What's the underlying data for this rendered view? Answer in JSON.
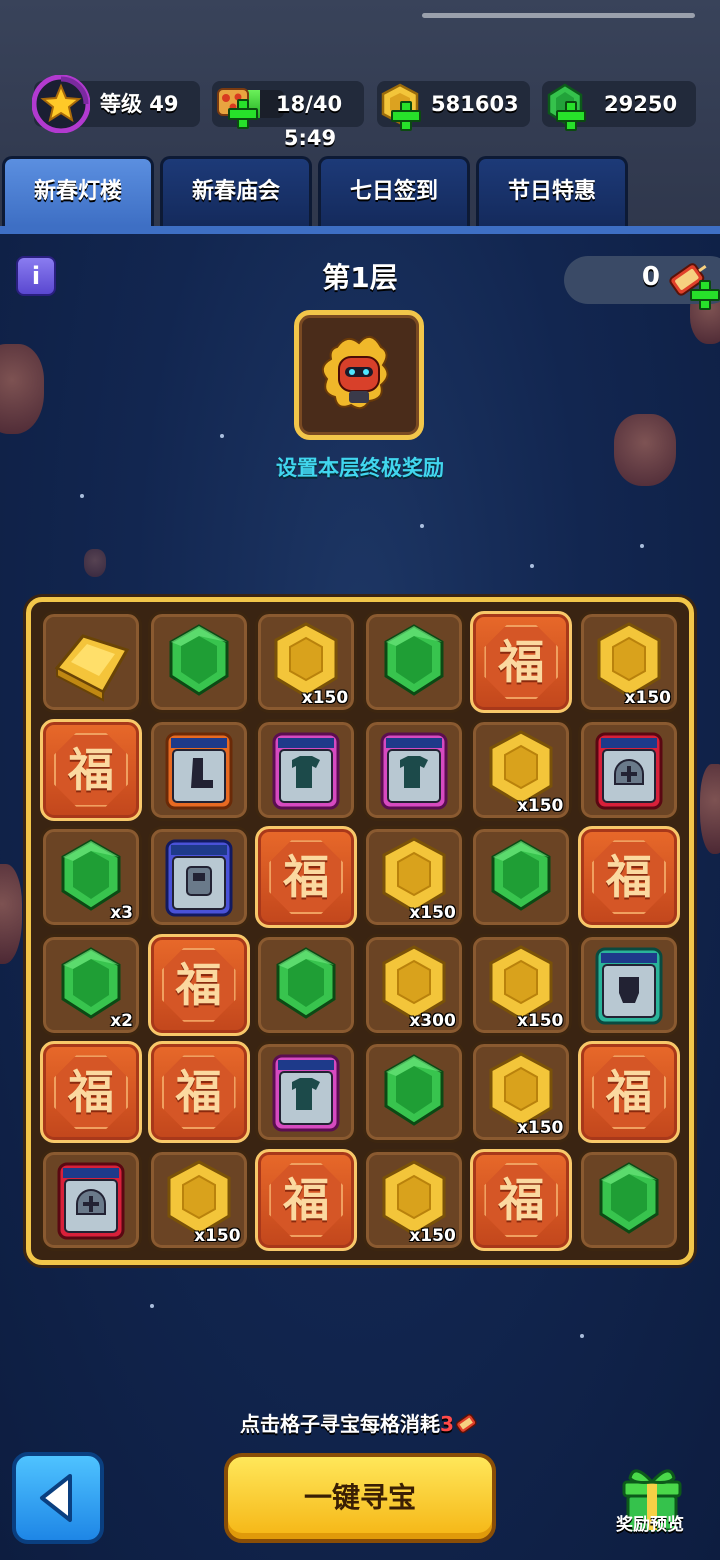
{
  "header": {
    "level_label": "等级 49",
    "energy": "18/40",
    "energy_fill": 0.45,
    "energy_timer": "5:49",
    "coins": "581603",
    "gems": "29250"
  },
  "tabs": [
    {
      "label": "新春灯楼",
      "active": true
    },
    {
      "label": "新春庙会",
      "active": false
    },
    {
      "label": "七日签到",
      "active": false
    },
    {
      "label": "节日特惠",
      "active": false
    }
  ],
  "floor": {
    "title": "第1层",
    "ticket_count": "0",
    "reward_label": "设置本层终极奖励"
  },
  "grid": [
    [
      {
        "type": "gold-bar",
        "qty": ""
      },
      {
        "type": "gem",
        "qty": ""
      },
      {
        "type": "coin",
        "qty": "x150"
      },
      {
        "type": "gem",
        "qty": ""
      },
      {
        "type": "fu",
        "qty": ""
      },
      {
        "type": "coin",
        "qty": "x150"
      }
    ],
    [
      {
        "type": "fu",
        "qty": ""
      },
      {
        "type": "card-orange-boot",
        "qty": ""
      },
      {
        "type": "card-pink-shirt",
        "qty": ""
      },
      {
        "type": "card-pink-shirt",
        "qty": ""
      },
      {
        "type": "coin",
        "qty": "x150"
      },
      {
        "type": "card-red-helmet",
        "qty": ""
      }
    ],
    [
      {
        "type": "gem",
        "qty": "x3"
      },
      {
        "type": "card-blue-armor",
        "qty": ""
      },
      {
        "type": "fu",
        "qty": ""
      },
      {
        "type": "coin",
        "qty": "x150"
      },
      {
        "type": "gem",
        "qty": ""
      },
      {
        "type": "fu",
        "qty": ""
      }
    ],
    [
      {
        "type": "gem",
        "qty": "x2"
      },
      {
        "type": "fu",
        "qty": ""
      },
      {
        "type": "gem",
        "qty": ""
      },
      {
        "type": "coin",
        "qty": "x300"
      },
      {
        "type": "coin",
        "qty": "x150"
      },
      {
        "type": "card-teal-glove",
        "qty": ""
      }
    ],
    [
      {
        "type": "fu",
        "qty": ""
      },
      {
        "type": "fu",
        "qty": ""
      },
      {
        "type": "card-pink-shirt",
        "qty": ""
      },
      {
        "type": "gem",
        "qty": ""
      },
      {
        "type": "coin",
        "qty": "x150"
      },
      {
        "type": "fu",
        "qty": ""
      }
    ],
    [
      {
        "type": "card-red-helmet",
        "qty": ""
      },
      {
        "type": "coin",
        "qty": "x150"
      },
      {
        "type": "fu",
        "qty": ""
      },
      {
        "type": "coin",
        "qty": "x150"
      },
      {
        "type": "fu",
        "qty": ""
      },
      {
        "type": "gem",
        "qty": ""
      }
    ]
  ],
  "fu_char": "福",
  "bottom": {
    "hint_before": "点击格子寻宝每格消耗",
    "hint_num": "3",
    "main_button": "一键寻宝",
    "gift_label": "奖励预览"
  },
  "colors": {
    "gold_border": "#f2c64a",
    "cyan_text": "#41d6ee",
    "fu_red": "#c2461c",
    "gem_green": "#2fb34a",
    "coin_gold": "#e8b830"
  }
}
